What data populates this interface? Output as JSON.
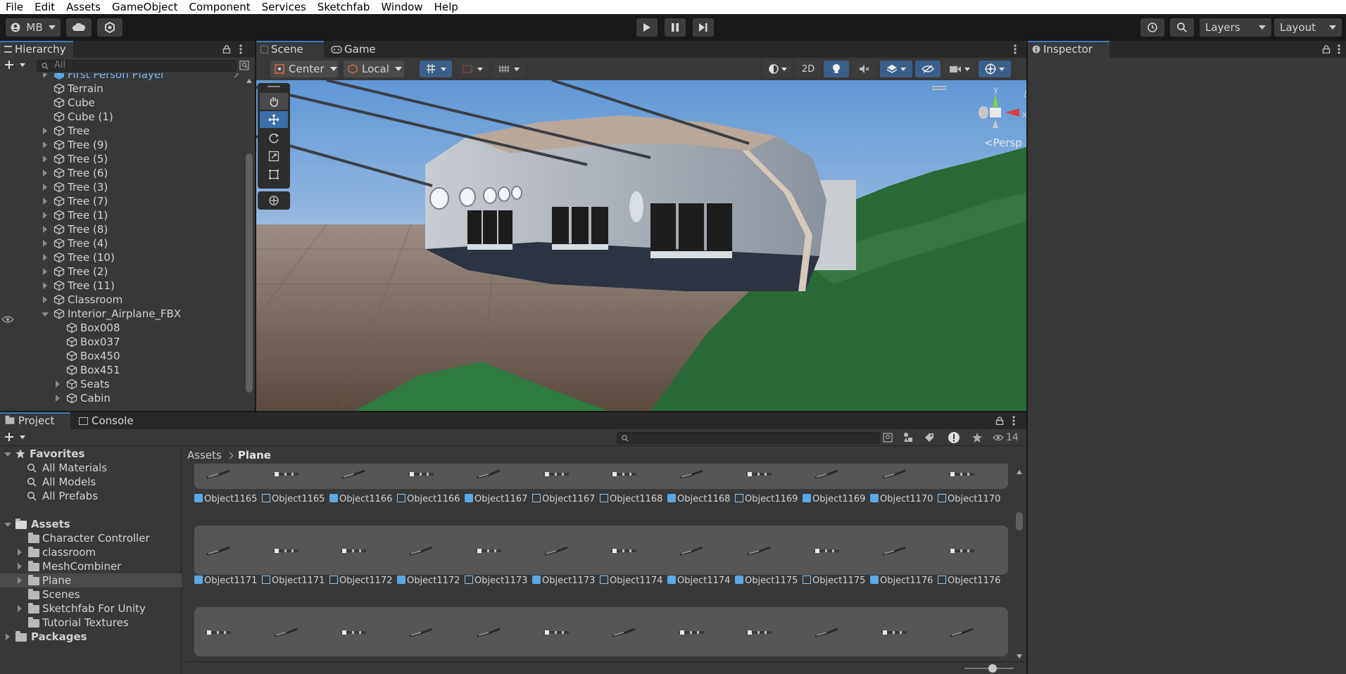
{
  "menu": [
    "File",
    "Edit",
    "Assets",
    "GameObject",
    "Component",
    "Services",
    "Sketchfab",
    "Window",
    "Help"
  ],
  "toolbar": {
    "account": "MB",
    "layers": "Layers",
    "layout": "Layout"
  },
  "hierarchy": {
    "tab": "Hierarchy",
    "search_placeholder": "All",
    "items": [
      {
        "label": "First Person Player",
        "indent": 0,
        "arrow": "right",
        "type": "prefab",
        "selected": true
      },
      {
        "label": "Terrain",
        "indent": 0,
        "arrow": "",
        "type": "object"
      },
      {
        "label": "Cube",
        "indent": 0,
        "arrow": "",
        "type": "object"
      },
      {
        "label": "Cube (1)",
        "indent": 0,
        "arrow": "",
        "type": "object"
      },
      {
        "label": "Tree",
        "indent": 0,
        "arrow": "right",
        "type": "object"
      },
      {
        "label": "Tree (9)",
        "indent": 0,
        "arrow": "right",
        "type": "object"
      },
      {
        "label": "Tree (5)",
        "indent": 0,
        "arrow": "right",
        "type": "object"
      },
      {
        "label": "Tree (6)",
        "indent": 0,
        "arrow": "right",
        "type": "object"
      },
      {
        "label": "Tree (3)",
        "indent": 0,
        "arrow": "right",
        "type": "object"
      },
      {
        "label": "Tree (7)",
        "indent": 0,
        "arrow": "right",
        "type": "object"
      },
      {
        "label": "Tree (1)",
        "indent": 0,
        "arrow": "right",
        "type": "object"
      },
      {
        "label": "Tree (8)",
        "indent": 0,
        "arrow": "right",
        "type": "object"
      },
      {
        "label": "Tree (4)",
        "indent": 0,
        "arrow": "right",
        "type": "object"
      },
      {
        "label": "Tree (10)",
        "indent": 0,
        "arrow": "right",
        "type": "object"
      },
      {
        "label": "Tree (2)",
        "indent": 0,
        "arrow": "right",
        "type": "object"
      },
      {
        "label": "Tree (11)",
        "indent": 0,
        "arrow": "right",
        "type": "object"
      },
      {
        "label": "Classroom",
        "indent": 0,
        "arrow": "right",
        "type": "object"
      },
      {
        "label": "Interior_Airplane_FBX",
        "indent": 0,
        "arrow": "down",
        "type": "object"
      },
      {
        "label": "Box008",
        "indent": 1,
        "arrow": "",
        "type": "object"
      },
      {
        "label": "Box037",
        "indent": 1,
        "arrow": "",
        "type": "object"
      },
      {
        "label": "Box450",
        "indent": 1,
        "arrow": "",
        "type": "object"
      },
      {
        "label": "Box451",
        "indent": 1,
        "arrow": "",
        "type": "object"
      },
      {
        "label": "Seats",
        "indent": 1,
        "arrow": "right",
        "type": "object"
      },
      {
        "label": "Cabin",
        "indent": 1,
        "arrow": "right",
        "type": "object"
      }
    ]
  },
  "scene": {
    "tabs": [
      "Scene",
      "Game"
    ],
    "pivot": "Center",
    "space": "Local",
    "mode_2d": "2D",
    "gizmo_label": "Persp",
    "axis_y": "y",
    "axis_x": "x"
  },
  "inspector": {
    "tab": "Inspector"
  },
  "project": {
    "tabs": [
      "Project",
      "Console"
    ],
    "hidden_count": "14",
    "breadcrumb": [
      "Assets",
      "Plane"
    ],
    "favorites_label": "Favorites",
    "favorites": [
      "All Materials",
      "All Models",
      "All Prefabs"
    ],
    "assets_label": "Assets",
    "folders": [
      {
        "label": "Character Controller",
        "arrow": false
      },
      {
        "label": "classroom",
        "arrow": true
      },
      {
        "label": "MeshCombiner",
        "arrow": true
      },
      {
        "label": "Plane",
        "arrow": true,
        "selected": true
      },
      {
        "label": "Scenes",
        "arrow": false
      },
      {
        "label": "Sketchfab For Unity",
        "arrow": true
      },
      {
        "label": "Tutorial Textures",
        "arrow": false
      }
    ],
    "packages_label": "Packages",
    "asset_rows": [
      [
        {
          "icon": "prefab",
          "label": "Object1165"
        },
        {
          "icon": "mesh",
          "label": "Object1165"
        },
        {
          "icon": "prefab",
          "label": "Object1166"
        },
        {
          "icon": "mesh",
          "label": "Object1166"
        },
        {
          "icon": "prefab",
          "label": "Object1167"
        },
        {
          "icon": "mesh",
          "label": "Object1167"
        },
        {
          "icon": "mesh",
          "label": "Object1168"
        },
        {
          "icon": "prefab",
          "label": "Object1168"
        },
        {
          "icon": "mesh",
          "label": "Object1169"
        },
        {
          "icon": "prefab",
          "label": "Object1169"
        },
        {
          "icon": "prefab",
          "label": "Object1170"
        },
        {
          "icon": "mesh",
          "label": "Object1170"
        }
      ],
      [
        {
          "icon": "prefab",
          "label": "Object1171"
        },
        {
          "icon": "mesh",
          "label": "Object1171"
        },
        {
          "icon": "mesh",
          "label": "Object1172"
        },
        {
          "icon": "prefab",
          "label": "Object1172"
        },
        {
          "icon": "mesh",
          "label": "Object1173"
        },
        {
          "icon": "prefab",
          "label": "Object1173"
        },
        {
          "icon": "mesh",
          "label": "Object1174"
        },
        {
          "icon": "prefab",
          "label": "Object1174"
        },
        {
          "icon": "prefab",
          "label": "Object1175"
        },
        {
          "icon": "mesh",
          "label": "Object1175"
        },
        {
          "icon": "prefab",
          "label": "Object1176"
        },
        {
          "icon": "mesh",
          "label": "Object1176"
        }
      ]
    ]
  },
  "colors": {
    "accent": "#3a79bb",
    "selection": "#2c5d87",
    "sky_top": "#6a9fd8",
    "sky_bottom": "#b9cfe6",
    "ground": "#7a6a5e",
    "terrain": "#2d6b3a"
  }
}
